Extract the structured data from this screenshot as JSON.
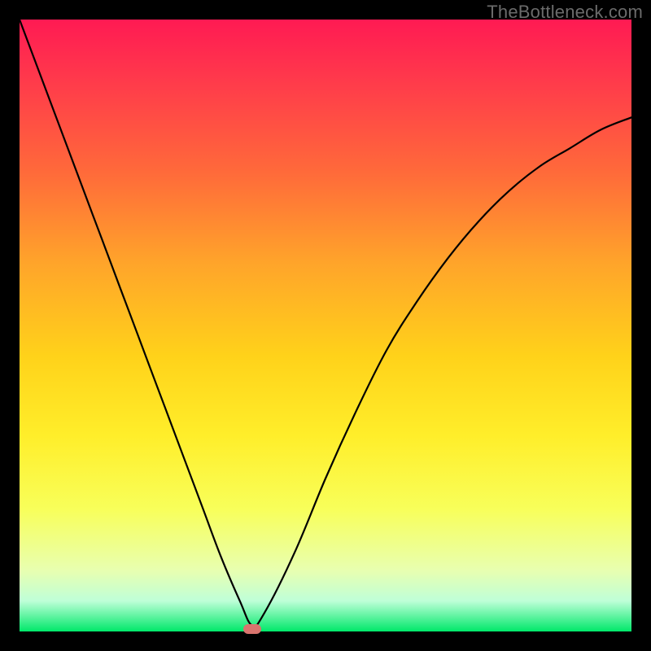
{
  "watermark": "TheBottleneck.com",
  "chart_data": {
    "type": "line",
    "title": "",
    "xlabel": "",
    "ylabel": "",
    "ylim": [
      0,
      100
    ],
    "x": [
      0.0,
      0.03,
      0.06,
      0.09,
      0.12,
      0.15,
      0.18,
      0.21,
      0.24,
      0.27,
      0.3,
      0.33,
      0.36,
      0.38,
      0.4,
      0.45,
      0.5,
      0.55,
      0.6,
      0.65,
      0.7,
      0.75,
      0.8,
      0.85,
      0.9,
      0.95,
      1.0
    ],
    "values": [
      100,
      92,
      84,
      76,
      68,
      60,
      52,
      44,
      36,
      28,
      20,
      12,
      5,
      1,
      3,
      13,
      25,
      36,
      46,
      54,
      61,
      67,
      72,
      76,
      79,
      82,
      84
    ],
    "optimum_x": 0.38,
    "optimum_y": 0,
    "background_gradient": {
      "top_color": "#ff1a53",
      "bottom_color": "#00e86a"
    }
  },
  "marker": {
    "color": "#d9746e"
  },
  "frame": {
    "inner_width": 752,
    "inner_height": 752,
    "border": 24
  }
}
